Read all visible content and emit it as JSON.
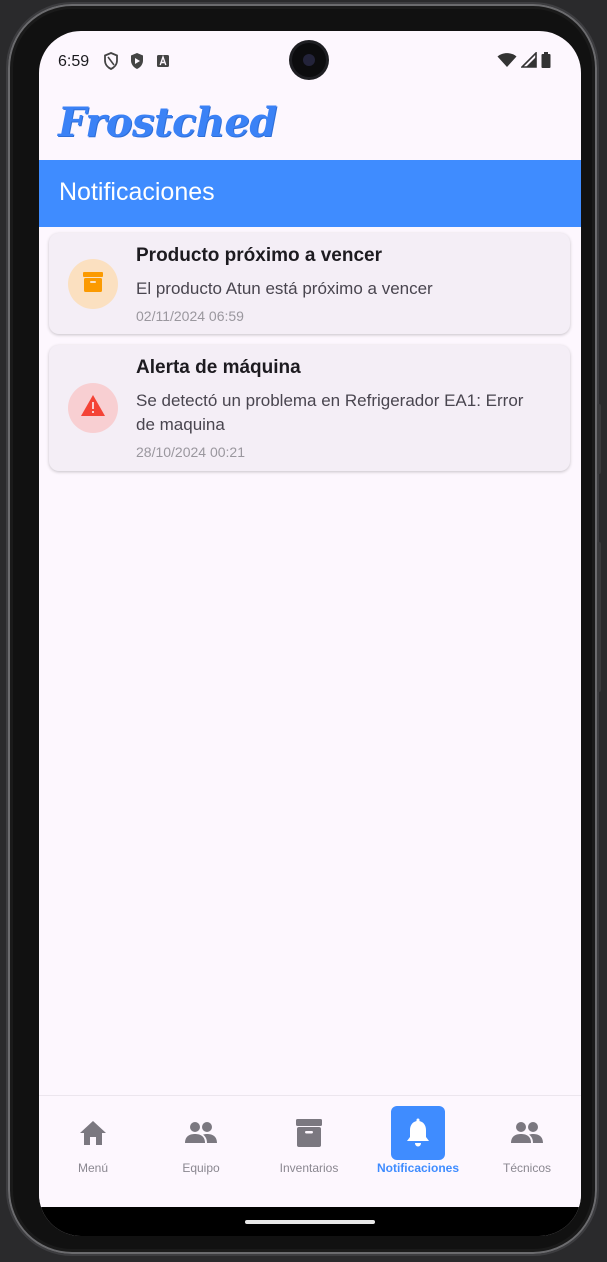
{
  "status_bar": {
    "time": "6:59"
  },
  "app": {
    "logo_text": "Frostched",
    "header_title": "Notificaciones"
  },
  "notifications": [
    {
      "title": "Producto próximo a vencer",
      "message": "El producto Atun está próximo a vencer",
      "date": "02/11/2024 06:59",
      "icon": "inventory-box-icon",
      "icon_color": "#fb9a00",
      "icon_bg": "#fbe0c0"
    },
    {
      "title": "Alerta de máquina",
      "message": "Se detectó un problema en Refrigerador EA1: Error de maquina",
      "date": "28/10/2024 00:21",
      "icon": "warning-triangle-icon",
      "icon_color": "#f44336",
      "icon_bg": "#f8cfd2"
    }
  ],
  "bottom_nav": {
    "items": [
      {
        "label": "Menú",
        "icon": "home-icon"
      },
      {
        "label": "Equipo",
        "icon": "group-icon"
      },
      {
        "label": "Inventarios",
        "icon": "inventory-box-icon"
      },
      {
        "label": "Notificaciones",
        "icon": "bell-icon",
        "active": true
      },
      {
        "label": "Técnicos",
        "icon": "group-icon"
      }
    ]
  },
  "colors": {
    "primary": "#3f8cff",
    "background": "#fdf7fe",
    "card": "#f4eef6"
  }
}
